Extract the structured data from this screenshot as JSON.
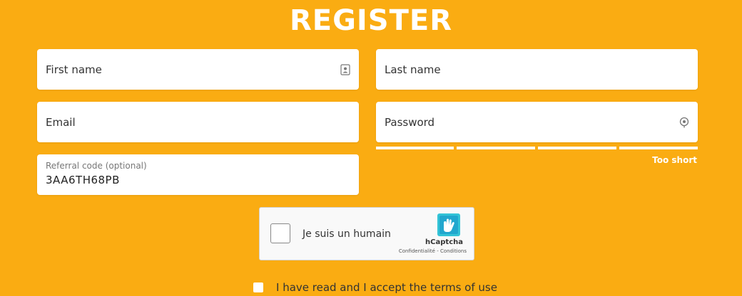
{
  "page": {
    "title": "REGISTER"
  },
  "form": {
    "first_name_placeholder": "First name",
    "last_name_placeholder": "Last name",
    "email_placeholder": "Email",
    "password_placeholder": "Password",
    "referral_label": "Referral code (optional)",
    "referral_value": "3AA6TH68PB",
    "password_strength": {
      "text": "Too short",
      "segments": 4
    }
  },
  "captcha": {
    "label": "Je suis un humain",
    "brand": "hCaptcha",
    "links": "Confidentialité - Conditions",
    "logo_icon": "hcaptcha-hand-logo"
  },
  "terms": {
    "label": "I have read and I accept the terms of use"
  },
  "icons": {
    "first_name": "contact-card-icon",
    "password": "password-visibility-icon"
  },
  "colors": {
    "background": "#FAAC12",
    "field": "#FFFFFF",
    "text": "#333333"
  }
}
